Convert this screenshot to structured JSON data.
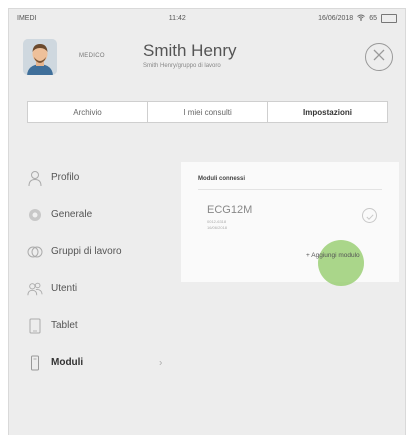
{
  "statusbar": {
    "carrier": "IMEDI",
    "time": "11:42",
    "date": "16/06/2018",
    "battery": "65"
  },
  "header": {
    "role": "MEDICO",
    "name": "Smith Henry",
    "subtitle": "Smith Henry/gruppo di lavoro"
  },
  "tabs": [
    {
      "label": "Archivio"
    },
    {
      "label": "I miei consulti"
    },
    {
      "label": "Impostazioni"
    }
  ],
  "menu": [
    {
      "label": "Profilo",
      "icon": "user-icon"
    },
    {
      "label": "Generale",
      "icon": "settings-icon"
    },
    {
      "label": "Gruppi di lavoro",
      "icon": "group-icon"
    },
    {
      "label": "Utenti",
      "icon": "users-icon"
    },
    {
      "label": "Tablet",
      "icon": "tablet-icon"
    },
    {
      "label": "Moduli",
      "icon": "module-icon"
    }
  ],
  "panel": {
    "title": "Moduli connessi",
    "module_name": "ECG12M",
    "module_line1": "0012-6318",
    "module_line2": "16/06/2018",
    "add_label": "+ Aggiungi modulo"
  },
  "colors": {
    "background": "#ededed",
    "panel": "#fafafa",
    "touch": "#96cd6e"
  }
}
